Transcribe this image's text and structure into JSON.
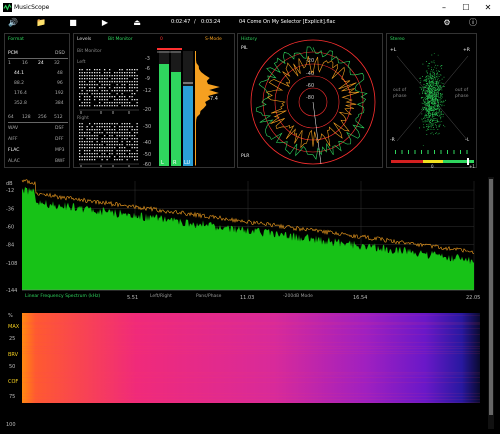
{
  "app": {
    "title": "MusicScope"
  },
  "toolbar": {
    "elapsed": "0:02:47",
    "separator": "/",
    "total": "0:03:24",
    "track": "04 Come On My Selector [Explicit].flac"
  },
  "format": {
    "title": "Format",
    "pcm": "PCM",
    "dsd": "DSD",
    "bits": [
      "1",
      "16",
      "24",
      "32"
    ],
    "pcm_rates": [
      "44.1",
      "88.2",
      "176.4",
      "352.8"
    ],
    "dsd_rates": [
      "48",
      "96",
      "192",
      "384"
    ],
    "dsd_multiples": [
      "64",
      "128",
      "256",
      "512"
    ],
    "types": [
      [
        "WAV",
        "DSF"
      ],
      [
        "AIFF",
        "DFF"
      ],
      [
        "FLAC",
        "MP3"
      ],
      [
        "ALAC",
        "BWF"
      ]
    ]
  },
  "levels": {
    "title": "Levels",
    "bit_monitor": "Bit Monitor",
    "bit_monitor_sub": "Bit Monitor",
    "left": "Left",
    "right": "Right",
    "s_mode": "S-Mode",
    "peak_value": "7.4",
    "scale": [
      "0",
      "-3",
      "-6",
      "-9",
      "-12",
      "-20",
      "-30",
      "-40",
      "-50",
      "-60"
    ],
    "channels": [
      "L",
      "R",
      "LU"
    ]
  },
  "history": {
    "title": "History",
    "pil": "PIL",
    "plr": "PLR",
    "rings": [
      "-20",
      "-40",
      "-60",
      "-80"
    ]
  },
  "stereo": {
    "title": "Stereo",
    "plus_l": "+L",
    "plus_r": "+R",
    "minus_l": "-L",
    "minus_r": "-R",
    "out_of_phase": "out of phase",
    "scale_min": "-1",
    "scale_mid": "0",
    "scale_max": "+1"
  },
  "spectrum": {
    "db_label": "dB",
    "db_ticks": [
      "-12",
      "-24",
      "-36",
      "-48",
      "-60",
      "-72",
      "-84",
      "-96",
      "-108",
      "-120",
      "-132",
      "-144"
    ],
    "freq_ticks": [
      "5.51",
      "11.03",
      "16.54",
      "22.05"
    ],
    "mode_label": "Linear Frequency Spectrum (kHz)",
    "left_right": "Left/Right",
    "pans_phase": "Pans/Phase",
    "mode_200": "-200dB Mode"
  },
  "spectrogram": {
    "percent_label": "%",
    "y_ticks": [
      "25",
      "50",
      "75",
      "100"
    ],
    "markers": [
      "MAX",
      "BRV",
      "COF"
    ]
  },
  "colors": {
    "green": "#2fd65e",
    "orange": "#f5a020",
    "blue": "#2aa0d8"
  }
}
